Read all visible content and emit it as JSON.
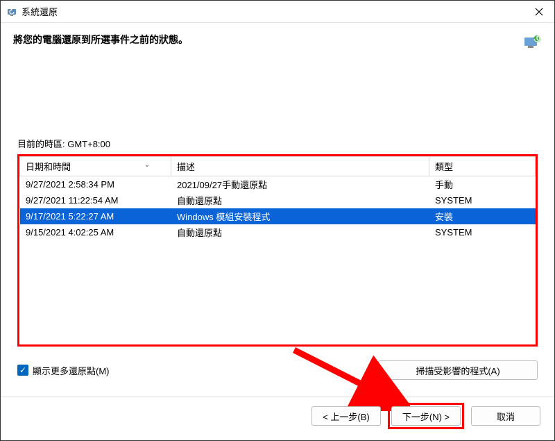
{
  "titlebar": {
    "title": "系統還原"
  },
  "header": {
    "text": "將您的電腦還原到所選事件之前的狀態。"
  },
  "timezone": {
    "label": "目前的時區: GMT+8:00"
  },
  "columns": {
    "date": "日期和時間",
    "desc": "描述",
    "type": "類型"
  },
  "rows": [
    {
      "date": "9/27/2021 2:58:34 PM",
      "desc": "2021/09/27手動還原點",
      "type": "手動",
      "selected": false
    },
    {
      "date": "9/27/2021 11:22:54 AM",
      "desc": "自動還原點",
      "type": "SYSTEM",
      "selected": false
    },
    {
      "date": "9/17/2021 5:22:27 AM",
      "desc": "Windows 模組安裝程式",
      "type": "安裝",
      "selected": true
    },
    {
      "date": "9/15/2021 4:02:25 AM",
      "desc": "自動還原點",
      "type": "SYSTEM",
      "selected": false
    }
  ],
  "checkbox": {
    "label": "顯示更多還原點(M)"
  },
  "scan": {
    "label": "掃描受影響的程式(A)"
  },
  "buttons": {
    "back": "< 上一步(B)",
    "next": "下一步(N) >",
    "cancel": "取消"
  }
}
